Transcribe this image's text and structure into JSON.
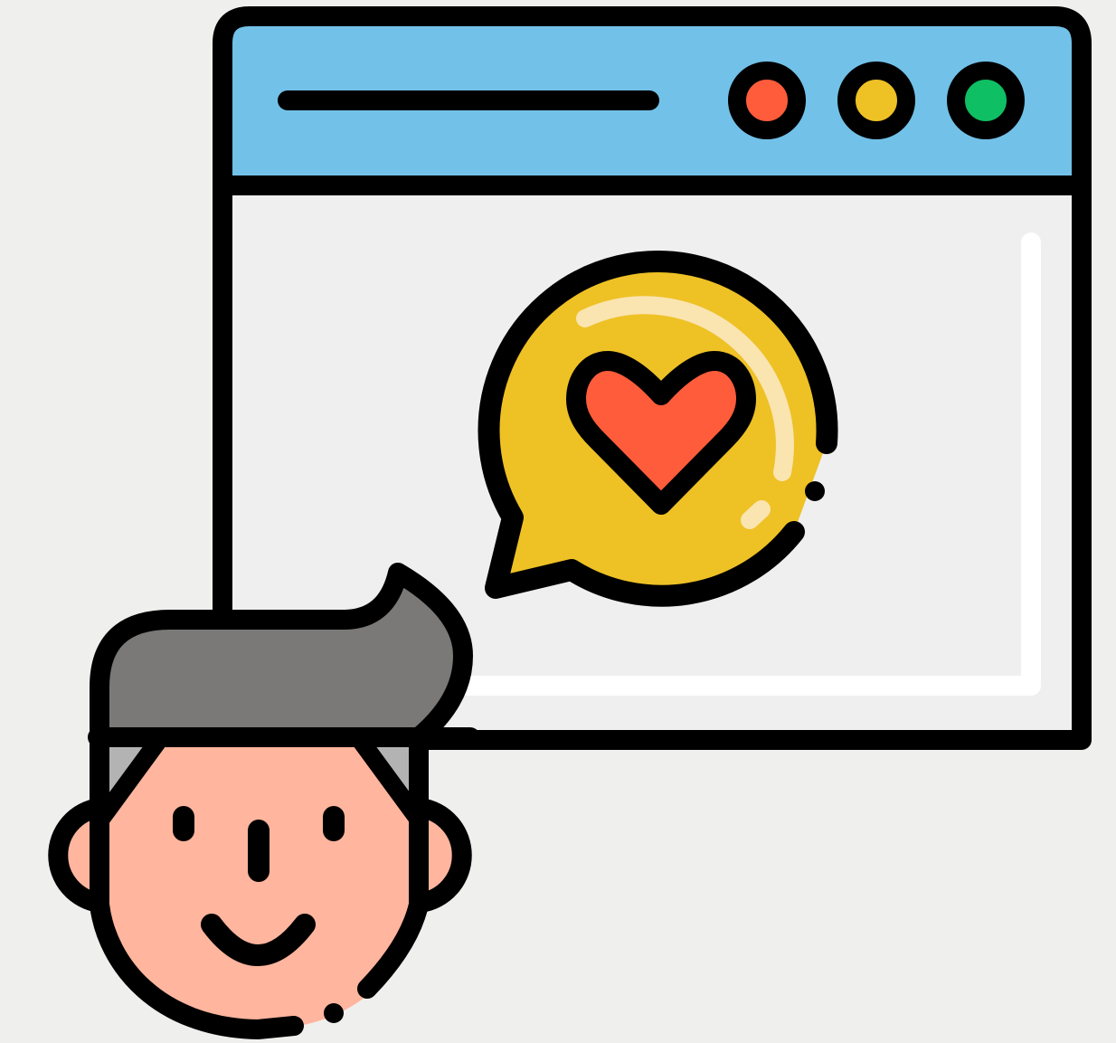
{
  "illustration": {
    "subject": "user-feedback-love-icon",
    "colors": {
      "background": "#efefed",
      "outline": "#000000",
      "titlebar": "#72c1e8",
      "window_body": "#efefef",
      "window_highlight": "#ffffff",
      "dot_red": "#ff5c3b",
      "dot_yellow": "#eec125",
      "dot_green": "#0fbf63",
      "bubble": "#eec125",
      "bubble_shine": "#fae4b0",
      "heart": "#ff5c3b",
      "hair_dark": "#7a7977",
      "hair_light": "#b3b3b3",
      "skin": "#ffb59e"
    },
    "icons": [
      "browser-window-icon",
      "speech-bubble-icon",
      "heart-icon",
      "person-avatar-icon"
    ]
  }
}
